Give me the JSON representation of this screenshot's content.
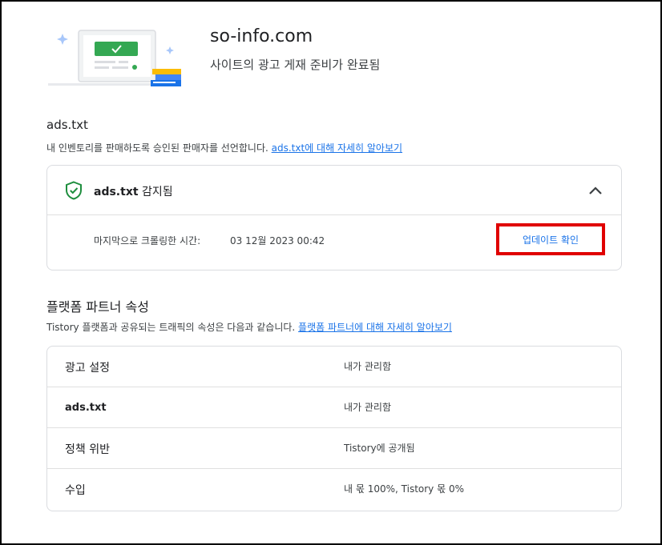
{
  "header": {
    "site_name": "so-info.com",
    "status": "사이트의 광고 게재 준비가 완료됨"
  },
  "ads_section": {
    "title": "ads.txt",
    "description": "내 인벤토리를 판매하도록 승인된 판매자를 선언합니다.",
    "learn_more": "ads.txt에 대해 자세히 알아보기",
    "status_name": "ads.txt",
    "status_text": "감지됨",
    "crawl_label": "마지막으로 크롤링한 시간:",
    "crawl_value": "03 12월 2023 00:42",
    "update_button": "업데이트 확인"
  },
  "platform_section": {
    "title": "플랫폼 파트너 속성",
    "description": "Tistory 플랫폼과 공유되는 트래픽의 속성은 다음과 같습니다.",
    "learn_more": "플랫폼 파트너에 대해 자세히 알아보기",
    "rows": [
      {
        "key": "광고 설정",
        "value": "내가 관리함"
      },
      {
        "key": "ads.txt",
        "value": "내가 관리함"
      },
      {
        "key": "정책 위반",
        "value": "Tistory에 공개됨"
      },
      {
        "key": "수입",
        "value": "내 몫 100%, Tistory 몫 0%"
      }
    ]
  },
  "icons": {
    "illustration": "site-ready-illustration",
    "shield": "shield-check-icon",
    "chevron": "chevron-up-icon"
  },
  "colors": {
    "link": "#1a73e8",
    "success": "#1e8e3e",
    "highlight": "#e00000"
  }
}
